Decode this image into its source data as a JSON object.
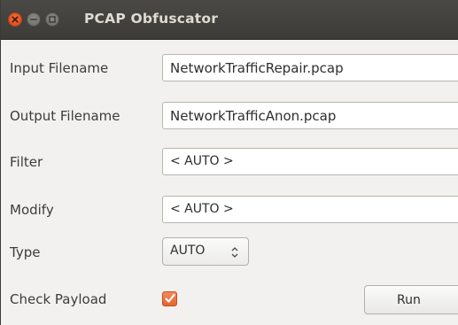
{
  "window": {
    "title": "PCAP Obfuscator"
  },
  "form": {
    "input_filename": {
      "label": "Input Filename",
      "value": "NetworkTrafficRepair.pcap"
    },
    "output_filename": {
      "label": "Output Filename",
      "value": "NetworkTrafficAnon.pcap"
    },
    "filter": {
      "label": "Filter",
      "value": "< AUTO >"
    },
    "modify": {
      "label": "Modify",
      "value": "< AUTO >"
    },
    "type": {
      "label": "Type",
      "selected": "AUTO"
    },
    "check_payload": {
      "label": "Check Payload",
      "checked": true
    },
    "run_label": "Run"
  },
  "colors": {
    "titlebar": "#3c3b37",
    "title_text": "#dfdbd2",
    "accent": "#e8682f",
    "window_bg": "#f2f1f0"
  },
  "icons": [
    "close-icon",
    "minimize-icon",
    "maximize-icon",
    "checkmark-icon",
    "updown-arrows-icon"
  ]
}
